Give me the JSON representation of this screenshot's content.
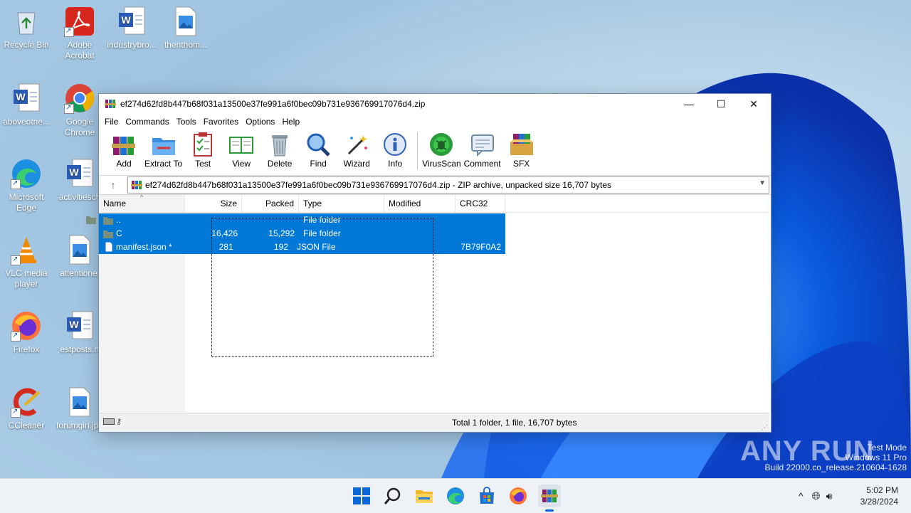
{
  "desktop": {
    "icons": [
      {
        "label": "Recycle Bin",
        "icon": "recycle-bin-icon"
      },
      {
        "label": "Adobe Acrobat",
        "icon": "adobe-acrobat-icon"
      },
      {
        "label": "industrybro...",
        "icon": "word-doc-icon"
      },
      {
        "label": "thenthom...",
        "icon": "image-file-icon"
      },
      {
        "label": "aboveothe...",
        "icon": "word-doc-icon"
      },
      {
        "label": "Google Chrome",
        "icon": "chrome-icon"
      },
      {
        "label": "Microsoft Edge",
        "icon": "edge-icon"
      },
      {
        "label": "activitiesch",
        "icon": "word-doc-icon"
      },
      {
        "label": "VLC media player",
        "icon": "vlc-icon"
      },
      {
        "label": "attentione.",
        "icon": "image-file-icon"
      },
      {
        "label": "Firefox",
        "icon": "firefox-icon"
      },
      {
        "label": "estposts.rt",
        "icon": "word-doc-icon"
      },
      {
        "label": "CCleaner",
        "icon": "ccleaner-icon"
      },
      {
        "label": "forumgirl.jpg",
        "icon": "image-file-icon"
      }
    ]
  },
  "window": {
    "title": "ef274d62fd8b447b68f031a13500e37fe991a6f0bec09b731e936769917076d4.zip",
    "controls": {
      "minimize": "—",
      "maximize": "☐",
      "close": "✕"
    },
    "menu": [
      "File",
      "Commands",
      "Tools",
      "Favorites",
      "Options",
      "Help"
    ],
    "toolbar": [
      {
        "label": "Add",
        "icon": "add-archive-icon"
      },
      {
        "label": "Extract To",
        "icon": "extract-folder-icon"
      },
      {
        "label": "Test",
        "icon": "test-clipboard-icon"
      },
      {
        "label": "View",
        "icon": "view-book-icon"
      },
      {
        "label": "Delete",
        "icon": "trash-bin-icon"
      },
      {
        "label": "Find",
        "icon": "magnifier-icon"
      },
      {
        "label": "Wizard",
        "icon": "wizard-wand-icon"
      },
      {
        "label": "Info",
        "icon": "info-icon"
      },
      {
        "label": "VirusScan",
        "icon": "virus-scan-icon"
      },
      {
        "label": "Comment",
        "icon": "comment-icon"
      },
      {
        "label": "SFX",
        "icon": "sfx-icon"
      }
    ],
    "address": "ef274d62fd8b447b68f031a13500e37fe991a6f0bec09b731e936769917076d4.zip - ZIP archive, unpacked size 16,707 bytes",
    "columns": [
      "Name",
      "Size",
      "Packed",
      "Type",
      "Modified",
      "CRC32"
    ],
    "rows": [
      {
        "name": "..",
        "size": "",
        "packed": "",
        "type": "File folder",
        "modified": "",
        "crc": "",
        "icon": "folder-icon"
      },
      {
        "name": "C",
        "size": "16,426",
        "packed": "15,292",
        "type": "File folder",
        "modified": "",
        "crc": "",
        "icon": "folder-icon"
      },
      {
        "name": "manifest.json *",
        "size": "281",
        "packed": "192",
        "type": "JSON File",
        "modified": "",
        "crc": "7B79F0A2",
        "icon": "file-icon"
      }
    ],
    "status": "Total 1 folder, 1 file, 16,707 bytes"
  },
  "taskbar": {
    "apps": [
      "start-icon",
      "search-icon",
      "file-explorer-icon",
      "edge-icon",
      "store-icon",
      "firefox-icon",
      "winrar-icon"
    ],
    "time": "5:02 PM",
    "date": "3/28/2024"
  },
  "watermark": {
    "line1": "Test Mode",
    "line2": "Windows 11 Pro",
    "line3": "Build 22000.co_release.210604-1628",
    "brand": "ANY RUN"
  }
}
